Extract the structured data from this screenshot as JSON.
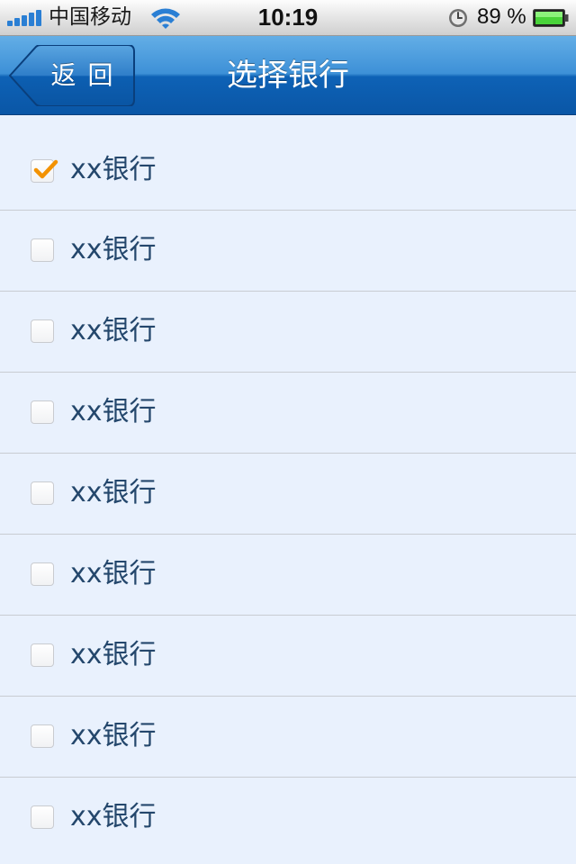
{
  "status_bar": {
    "carrier": "中国移动",
    "time": "10:19",
    "battery_percent": "89 %"
  },
  "nav": {
    "back_label": "返 回",
    "title": "选择银行"
  },
  "banks": [
    {
      "name": "xx银行",
      "checked": true
    },
    {
      "name": "xx银行",
      "checked": false
    },
    {
      "name": "xx银行",
      "checked": false
    },
    {
      "name": "xx银行",
      "checked": false
    },
    {
      "name": "xx银行",
      "checked": false
    },
    {
      "name": "xx银行",
      "checked": false
    },
    {
      "name": "xx银行",
      "checked": false
    },
    {
      "name": "xx银行",
      "checked": false
    },
    {
      "name": "xx银行",
      "checked": false
    }
  ],
  "colors": {
    "nav_blue": "#0e62b6",
    "list_background": "#e9f1fd",
    "check_accent": "#f39200",
    "bank_text": "#24476c"
  },
  "icons": {
    "signal": "signal-bars-icon",
    "wifi": "wifi-icon",
    "alarm": "clock-icon",
    "battery": "battery-icon",
    "back": "back-arrow-button",
    "check": "checkmark-icon"
  }
}
